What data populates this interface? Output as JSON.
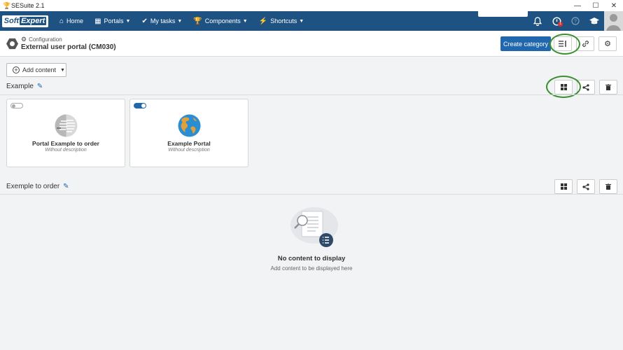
{
  "window": {
    "title": "SESuite 2.1",
    "controls": [
      "—",
      "☐",
      "✕"
    ]
  },
  "navbar": {
    "logo": {
      "part1": "Soft",
      "part2": "Expert"
    },
    "items": [
      {
        "label": "Home",
        "icon": "home-icon",
        "caret": false
      },
      {
        "label": "Portals",
        "icon": "grid-icon",
        "caret": true
      },
      {
        "label": "My tasks",
        "icon": "check-icon",
        "caret": true
      },
      {
        "label": "Components",
        "icon": "trophy-icon",
        "caret": true
      },
      {
        "label": "Shortcuts",
        "icon": "bolt-icon",
        "caret": true
      }
    ],
    "search_placeholder": "",
    "notification_badge": "1"
  },
  "header": {
    "breadcrumb": "Configuration",
    "title": "External user portal (CM030)",
    "create_label": "Create category"
  },
  "toolbar": {
    "add_content_label": "Add content"
  },
  "sections": [
    {
      "title": "Example",
      "cards": [
        {
          "title": "Portal Example to order",
          "description": "Without description",
          "enabled": false
        },
        {
          "title": "Example Portal",
          "description": "Without description",
          "enabled": true
        }
      ]
    },
    {
      "title": "Exemple to order",
      "empty_title": "No content to display",
      "empty_subtitle": "Add content to be displayed here"
    }
  ],
  "colors": {
    "navbar": "#1e5282",
    "primary": "#2167ae",
    "highlight": "#3a8f2f"
  }
}
